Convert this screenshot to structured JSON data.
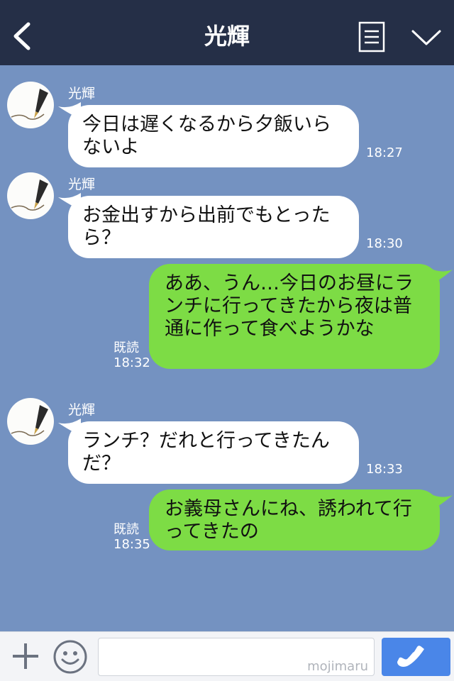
{
  "header": {
    "title": "光輝",
    "back_icon": "chevron-left-icon",
    "menu_icon": "menu-icon",
    "collapse_icon": "chevron-down-icon"
  },
  "messages": [
    {
      "type": "in",
      "sender": "光輝",
      "text": "今日は遅くなるから夕飯いらないよ",
      "time": "18:27"
    },
    {
      "type": "in",
      "sender": "光輝",
      "text": "お金出すから出前でもとったら？",
      "time": "18:30"
    },
    {
      "type": "out",
      "text": "ああ、うん…今日のお昼にランチに行ってきたから夜は普通に作って食べようかな",
      "read": "既読",
      "time": "18:32"
    },
    {
      "type": "in",
      "sender": "光輝",
      "text": "ランチ？だれと行ってきたんだ？",
      "time": "18:33"
    },
    {
      "type": "out",
      "text": "お義母さんにね、誘われて行ってきたの",
      "read": "既読",
      "time": "18:35"
    }
  ],
  "footer": {
    "watermark": "mojimaru",
    "plus_icon": "plus-icon",
    "emoji_icon": "smiley-icon",
    "call_icon": "phone-icon"
  },
  "colors": {
    "header_bg": "#252f47",
    "chat_bg": "#7492c1",
    "incoming_bubble": "#ffffff",
    "outgoing_bubble": "#7ddc45",
    "call_button": "#4a86e8"
  }
}
